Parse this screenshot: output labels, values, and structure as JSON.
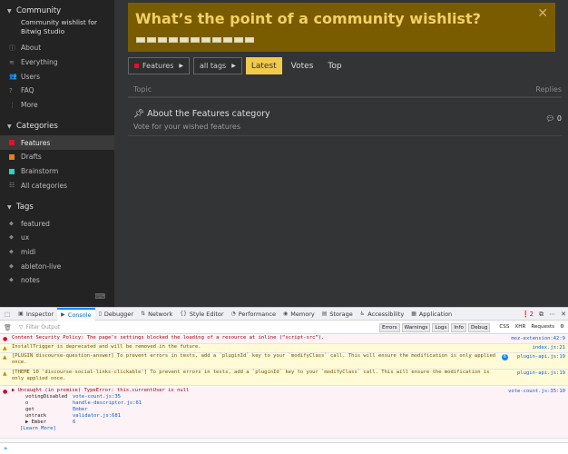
{
  "sidebar": {
    "community_heading": "Community",
    "community_sub": "Community wishlist for Bitwig Studio",
    "community_items": [
      {
        "label": "About",
        "icon": "info-icon"
      },
      {
        "label": "Everything",
        "icon": "layers-icon"
      },
      {
        "label": "Users",
        "icon": "users-icon"
      },
      {
        "label": "FAQ",
        "icon": "question-icon"
      },
      {
        "label": "More",
        "icon": "more-icon"
      }
    ],
    "categories_heading": "Categories",
    "categories": [
      {
        "label": "Features",
        "color": "#e0112a",
        "active": true
      },
      {
        "label": "Drafts",
        "color": "#e77e1b"
      },
      {
        "label": "Brainstorm",
        "color": "#2ed0c8"
      },
      {
        "label": "All categories",
        "icon": "grid-icon"
      }
    ],
    "tags_heading": "Tags",
    "tags": [
      "featured",
      "ux",
      "midi",
      "ableton-live",
      "notes"
    ]
  },
  "banner": {
    "title": "What’s the point of a community wishlist?",
    "close": "✕"
  },
  "nav": {
    "category_dropdown": "Features",
    "category_color": "#e0112a",
    "tags_dropdown": "all tags",
    "tabs": [
      "Latest",
      "Votes",
      "Top"
    ],
    "active_tab": "Latest"
  },
  "topics": {
    "col_topic": "Topic",
    "col_replies": "Replies",
    "rows": [
      {
        "title": "About the Features category",
        "excerpt": "Vote for your wished features",
        "replies": "0"
      }
    ]
  },
  "devtools": {
    "tabs": [
      {
        "label": "Inspector",
        "icon": "inspector-icon"
      },
      {
        "label": "Console",
        "icon": "console-icon",
        "active": true
      },
      {
        "label": "Debugger",
        "icon": "debugger-icon"
      },
      {
        "label": "Network",
        "icon": "network-icon"
      },
      {
        "label": "Style Editor",
        "icon": "style-editor-icon"
      },
      {
        "label": "Performance",
        "icon": "performance-icon"
      },
      {
        "label": "Memory",
        "icon": "memory-icon"
      },
      {
        "label": "Storage",
        "icon": "storage-icon"
      },
      {
        "label": "Accessibility",
        "icon": "accessibility-icon"
      },
      {
        "label": "Application",
        "icon": "application-icon"
      }
    ],
    "error_count": "2",
    "filter_placeholder": "Filter Output",
    "filters": [
      "Errors",
      "Warnings",
      "Logs",
      "Info",
      "Debug"
    ],
    "filter_extra": [
      "CSS",
      "XHR",
      "Requests"
    ],
    "logs": [
      {
        "type": "error",
        "msg": "Content Security Policy: The page’s settings blocked the loading of a resource at inline (“script-src”).",
        "src": "moz-extension:42:9"
      },
      {
        "type": "warn",
        "msg": "InstallTrigger is deprecated and will be removed in the future.",
        "src": "index.js:21"
      },
      {
        "type": "warn",
        "msg": "[PLUGIN discourse-question-answer] To prevent errors in tests, add a `pluginId` key to your `modifyClass` call. This will ensure the modification is only applied once.",
        "src": "plugin-api.js:19",
        "badge": "6"
      },
      {
        "type": "warn",
        "msg": "[THEME 10 'discourse-social-links-clickable'] To prevent errors in tests, add a `pluginId` key to your `modifyClass` call. This will ensure the modification is only applied once.",
        "src": "plugin-api.js:19"
      },
      {
        "type": "error",
        "msg": "▶ Uncaught (in promise) TypeError: this.currentUser is null",
        "src": "vote-count.js:35:10"
      }
    ],
    "stack": [
      {
        "fn": "votingDisabled",
        "loc": "vote-count.js:35"
      },
      {
        "fn": "o",
        "loc": "handle-descriptor.js:61"
      },
      {
        "fn": "get",
        "loc": "Ember"
      },
      {
        "fn": "untrack",
        "loc": "validator.js:681"
      },
      {
        "fn": "▶ Ember",
        "loc": "6"
      }
    ],
    "learn_more": "[Learn More]",
    "prompt": "»"
  }
}
